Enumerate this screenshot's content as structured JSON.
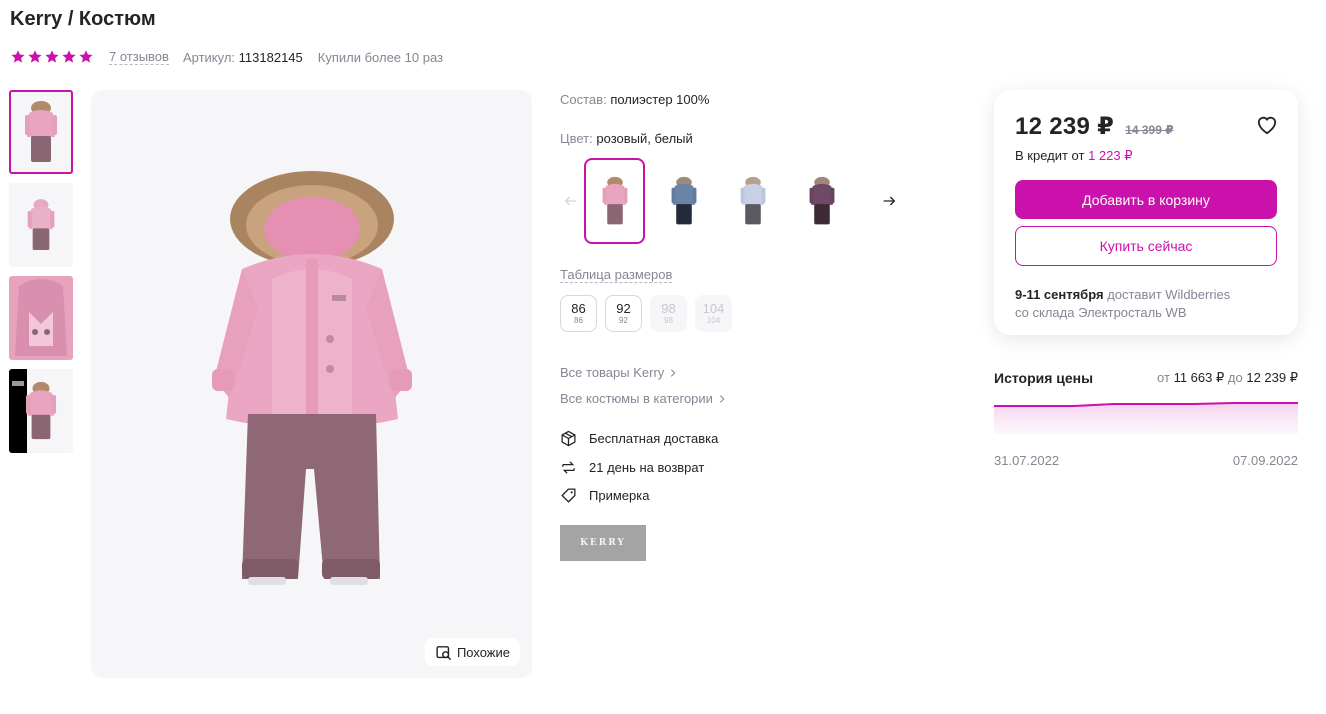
{
  "product": {
    "title": "Kerry / Костюм",
    "rating_stars": 5,
    "reviews": "7 отзывов",
    "article_label": "Артикул:",
    "article_value": "113182145",
    "bought": "Купили более 10 раз"
  },
  "gallery": {
    "similar_label": "Похожие"
  },
  "details": {
    "composition_label": "Состав:",
    "composition_value": "полиэстер 100%",
    "color_label": "Цвет:",
    "color_value": "розовый, белый",
    "size_table_link": "Таблица размеров",
    "sizes": [
      {
        "main": "86",
        "sub": "86"
      },
      {
        "main": "92",
        "sub": "92"
      },
      {
        "main": "98",
        "sub": "98"
      },
      {
        "main": "104",
        "sub": "104"
      }
    ],
    "all_brand_link": "Все товары Kerry",
    "all_category_link": "Все костюмы в категории",
    "features": [
      "Бесплатная доставка",
      "21 день на возврат",
      "Примерка"
    ],
    "brand_logo_text": "KERRY"
  },
  "buy_card": {
    "price": "12 239 ₽",
    "old_price": "14 399 ₽",
    "credit_label": "В кредит от",
    "credit_value": "1 223 ₽",
    "add_to_cart": "Добавить в корзину",
    "buy_now": "Купить сейчас",
    "delivery_date": "9-11 сентября",
    "delivery_text": "доставит Wildberries",
    "delivery_from": "со склада Электросталь WB"
  },
  "price_history": {
    "title": "История цены",
    "range_from_label": "от",
    "range_from": "11 663 ₽",
    "range_to_label": "до",
    "range_to": "12 239 ₽",
    "date_start": "31.07.2022",
    "date_end": "07.09.2022"
  },
  "colors": {
    "accent": "#cb11ab",
    "text": "#242424",
    "muted": "#868695"
  }
}
